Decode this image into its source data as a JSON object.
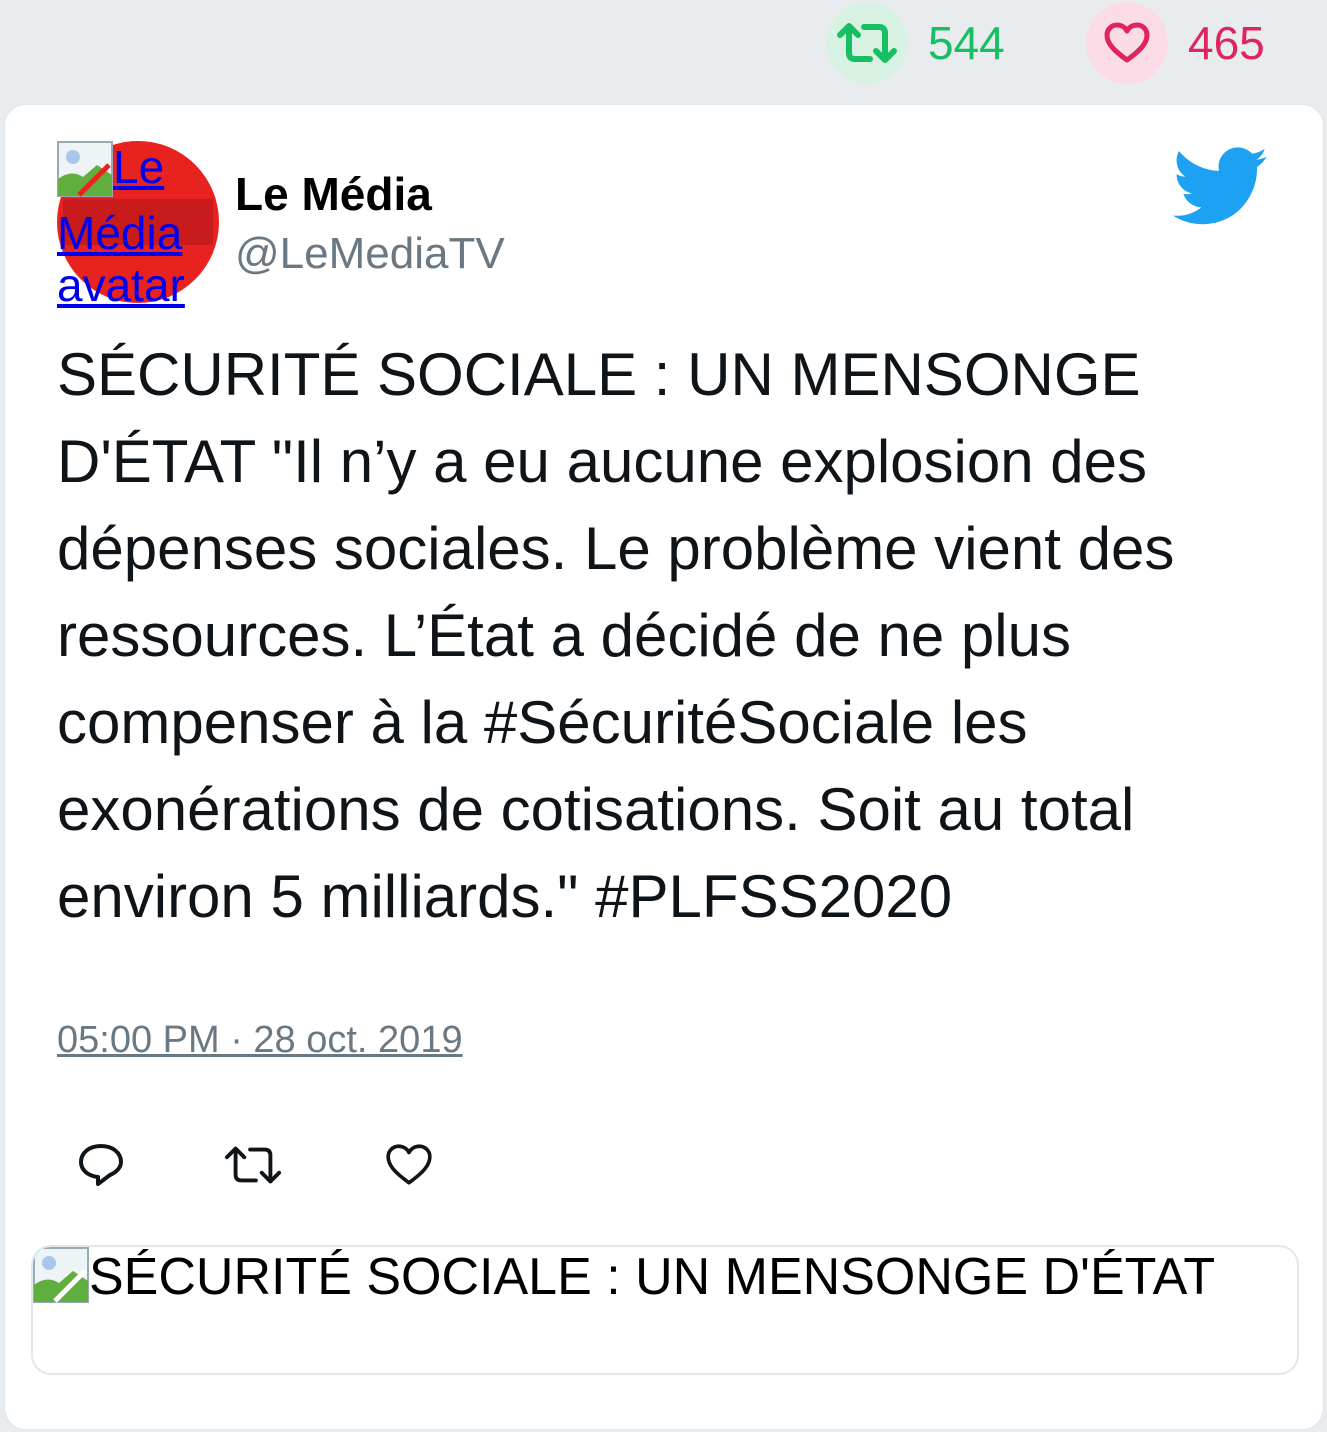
{
  "stats": {
    "retweets": "544",
    "likes": "465",
    "retweet_color": "#17bf63",
    "like_color": "#e0245e"
  },
  "author": {
    "name": "Le Média",
    "handle": "@LeMediaTV",
    "avatar_alt": "Le Média avatar",
    "avatar_color": "#e8231f"
  },
  "tweet": {
    "text": "SÉCURITÉ SOCIALE : UN MENSONGE D'ÉTAT \"Il n’y a eu aucune explosion des dépenses sociales. Le problème vient des ressources. L’État a décidé de ne plus compenser à la #SécuritéSociale les exonérations de cotisations. Soit au total environ 5 milliards.\" #PLFSS2020",
    "timestamp": "05:00 PM · 28 oct. 2019"
  },
  "icons": {
    "retweet": "retweet-icon",
    "like": "heart-icon",
    "reply": "reply-icon",
    "brand": "twitter-bird-icon"
  },
  "link_card": {
    "image_alt": "SÉCURITÉ SOCIALE : UN MENSONGE D'ÉTAT"
  },
  "brand_color": "#1da1f2"
}
